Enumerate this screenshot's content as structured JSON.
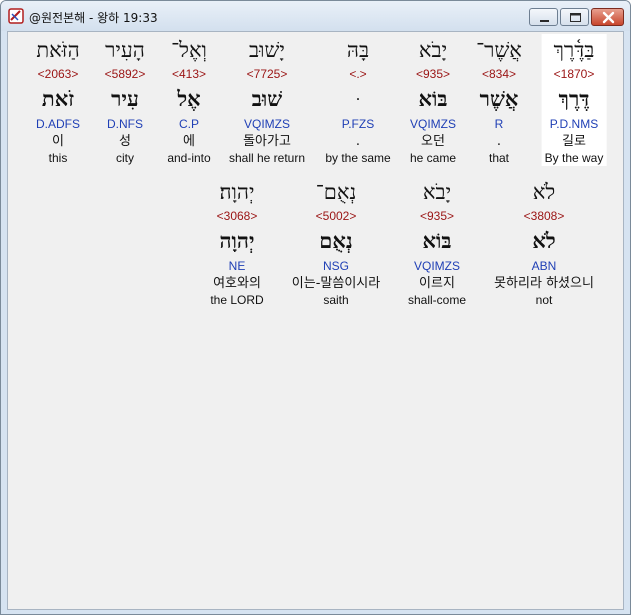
{
  "window": {
    "title": "@원전본해 - 왕하 19:33"
  },
  "verse_rows": [
    {
      "words": [
        {
          "hebrew": "בַּדֶּ֫רֶךְ",
          "strong": "<1870>",
          "root": "דֶּרֶךְ",
          "morph": "P.D.NMS",
          "korean": "길로",
          "english": "By the way"
        },
        {
          "hebrew": "אֲשֶׁר־",
          "strong": "<834>",
          "root": "אֲשֶׁר",
          "morph": "R",
          "korean": ".",
          "english": "that"
        },
        {
          "hebrew": "יָבֹא",
          "strong": "<935>",
          "root": "בּוֹא",
          "morph": "VQIMZS",
          "korean": "오던",
          "english": "he came"
        },
        {
          "hebrew": "בָּהּ",
          "strong": "<.>",
          "root": "ּ",
          "morph": "P.FZS",
          "korean": ".",
          "english": "by the same"
        },
        {
          "hebrew": "יָשׁוּב",
          "strong": "<7725>",
          "root": "שׁוּב",
          "morph": "VQIMZS",
          "korean": "돌아가고",
          "english": "shall he return"
        },
        {
          "hebrew": "וְאֶל־",
          "strong": "<413>",
          "root": "אֶל",
          "morph": "C.P",
          "korean": "에",
          "english": "and-into"
        },
        {
          "hebrew": "הָעִיר",
          "strong": "<5892>",
          "root": "עִיר",
          "morph": "D.NFS",
          "korean": "성",
          "english": "city"
        },
        {
          "hebrew": "הַזֹּאת",
          "strong": "<2063>",
          "root": "זֹאת",
          "morph": "D.ADFS",
          "korean": "이",
          "english": "this"
        }
      ]
    },
    {
      "words": [
        {
          "hebrew": "לֹא",
          "strong": "<3808>",
          "root": "לֹא",
          "morph": "ABN",
          "korean": "못하리라 하셨으니",
          "english": "not"
        },
        {
          "hebrew": "יָבֹא",
          "strong": "<935>",
          "root": "בּוֹא",
          "morph": "VQIMZS",
          "korean": "이르지",
          "english": "shall-come"
        },
        {
          "hebrew": "נְאֻם־",
          "strong": "<5002>",
          "root": "נְאֻם",
          "morph": "NSG",
          "korean": "이는-말씀이시라",
          "english": "saith"
        },
        {
          "hebrew": "יְהוָה׃",
          "strong": "<3068>",
          "root": "יְהוָה",
          "morph": "NE",
          "korean": "여호와의",
          "english": "the LORD"
        }
      ]
    }
  ]
}
